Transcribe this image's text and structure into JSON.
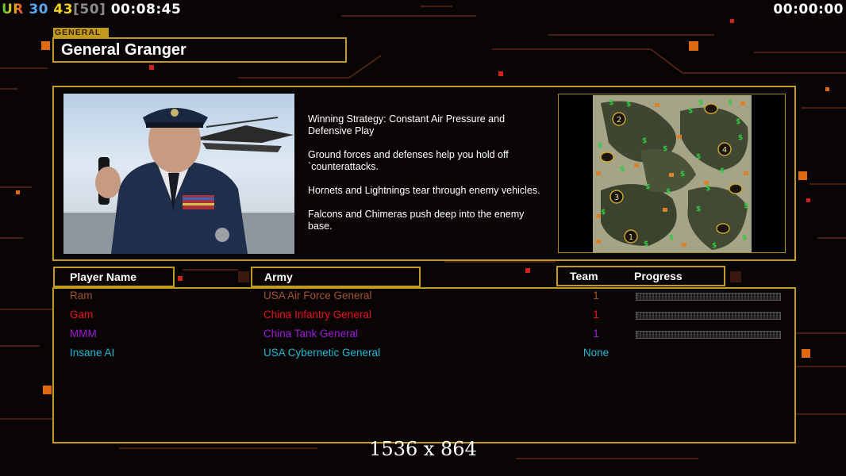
{
  "hud": {
    "label": "UR",
    "value_a": "30",
    "value_b": "43",
    "value_c": "[50]",
    "elapsed": "00:08:45",
    "timer": "00:00:00"
  },
  "colors": {
    "accent": "#c09a1c",
    "ram": "#a0522d",
    "gam": "#e8121a",
    "mmm": "#9a1ad6",
    "ai": "#1ab8d6"
  },
  "general": {
    "section_tag": "GENERAL",
    "name": "General Granger",
    "strategy": [
      "Winning Strategy: Constant Air Pressure and\n Defensive Play",
      "Ground forces and defenses help you hold off\n`counterattacks.",
      "Hornets and Lightnings tear through enemy vehicles.",
      "Falcons and Chimeras push deep into the enemy\n base."
    ]
  },
  "minimap": {
    "start_positions": [
      "1",
      "2",
      "3",
      "4"
    ]
  },
  "table": {
    "headers": {
      "player": "Player Name",
      "army": "Army",
      "team": "Team",
      "progress": "Progress"
    },
    "rows": [
      {
        "name": "Ram",
        "army": "USA Air Force General",
        "team": "1",
        "progress": 0,
        "color": "#a0522d"
      },
      {
        "name": "Gam",
        "army": "China Infantry General",
        "team": "1",
        "progress": 0,
        "color": "#e8121a"
      },
      {
        "name": "MMM",
        "army": "China Tank General",
        "team": "1",
        "progress": 0,
        "color": "#9a1ad6"
      },
      {
        "name": "Insane AI",
        "army": "USA Cybernetic General",
        "team": "None",
        "color": "#1ab8d6"
      }
    ]
  },
  "overlay": {
    "resolution": "1536 x 864"
  }
}
